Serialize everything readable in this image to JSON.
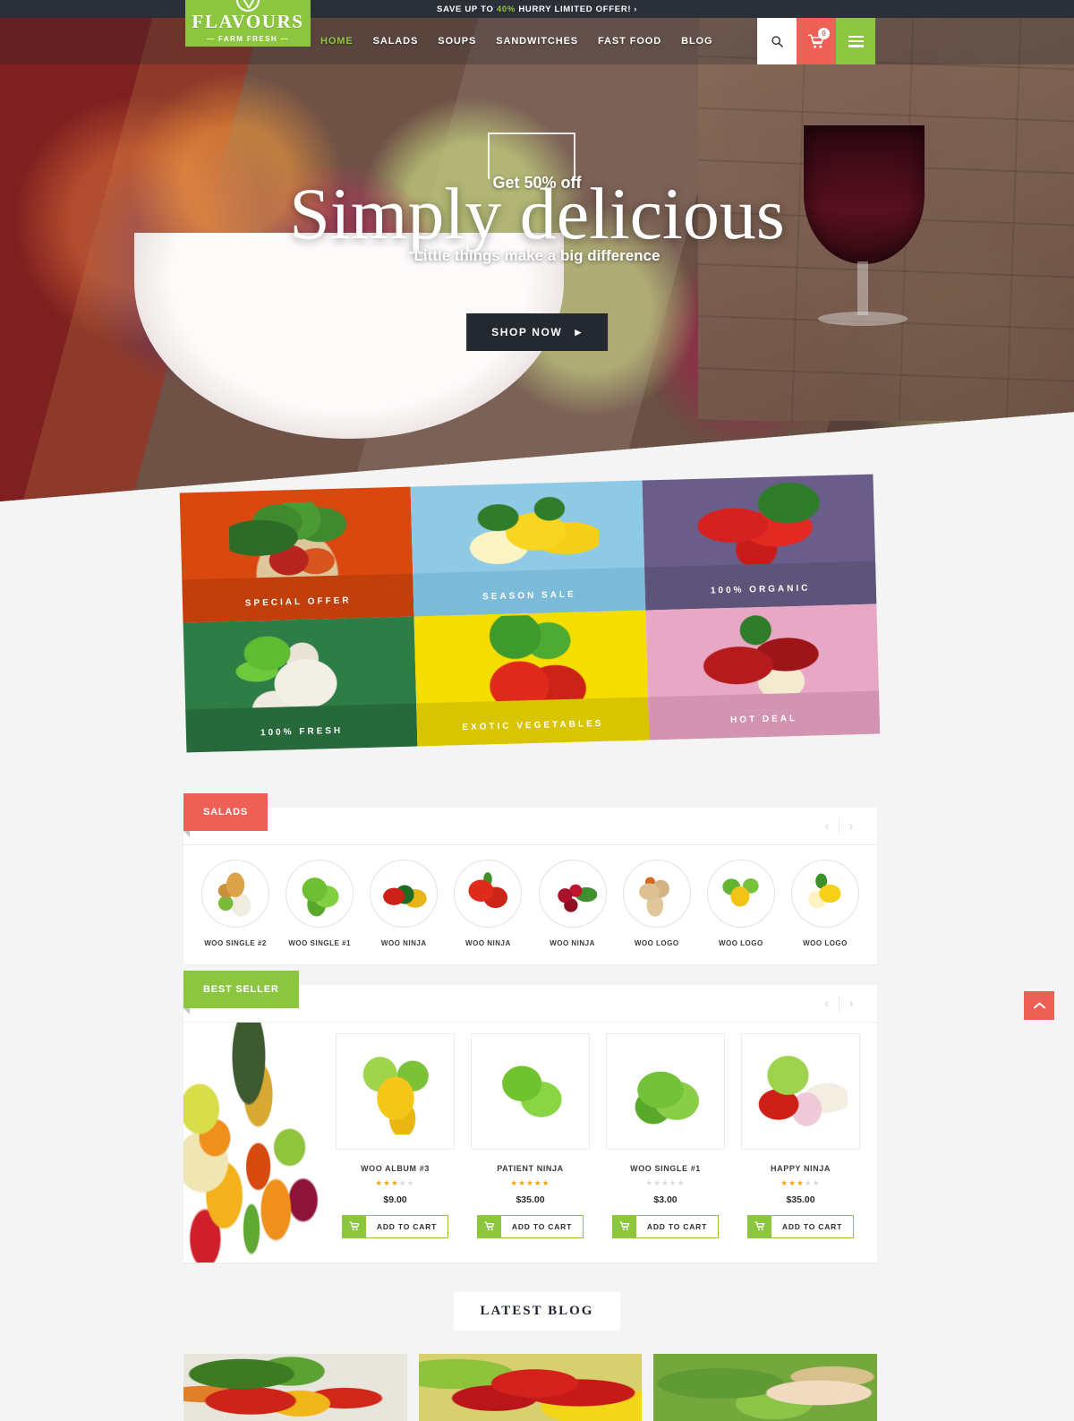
{
  "announcement": {
    "prefix": "SAVE UP TO ",
    "percent": "40%",
    "suffix": " HURRY LIMITED OFFER!",
    "arrow": "›"
  },
  "header": {
    "logo": {
      "name": "FLAVOURS",
      "tagline": "— FARM FRESH —",
      "icon": "lime-slice-icon"
    },
    "nav": [
      {
        "label": "HOME",
        "active": true
      },
      {
        "label": "SALADS",
        "active": false
      },
      {
        "label": "SOUPS",
        "active": false
      },
      {
        "label": "SANDWITCHES",
        "active": false
      },
      {
        "label": "FAST FOOD",
        "active": false
      },
      {
        "label": "BLOG",
        "active": false
      }
    ],
    "actions": {
      "search_icon": "search-icon",
      "cart_icon": "cart-icon",
      "cart_count": "0",
      "menu_icon": "hamburger-menu-icon"
    },
    "colors": {
      "green": "#8cc63e",
      "red": "#ee6055",
      "dark": "#2b2f38"
    }
  },
  "hero": {
    "kicker": "Get 50% off",
    "title": "Simply delicious",
    "subtitle": "Little things make a big difference",
    "cta": "SHOP NOW",
    "cta_caret": "▶"
  },
  "categories": [
    {
      "label": "SPECIAL OFFER",
      "bg": "#d9480f",
      "band": "#c23f0c",
      "art": "p-broccoli"
    },
    {
      "label": "SEASON SALE",
      "bg": "#8ecae6",
      "band": "#7cbada",
      "art": "p-lemon"
    },
    {
      "label": "100% ORGANIC",
      "bg": "#6a5d8a",
      "band": "#5e5379",
      "art": "p-straw"
    },
    {
      "label": "100% FRESH",
      "bg": "#2e7d46",
      "band": "#27693b",
      "art": "p-garlic"
    },
    {
      "label": "EXOTIC VEGETABLES",
      "bg": "#f5dd00",
      "band": "#d9c400",
      "art": "p-tomato"
    },
    {
      "label": "HOT DEAL",
      "bg": "#e8a7c4",
      "band": "#d294b0",
      "art": "p-apple"
    }
  ],
  "salads": {
    "tab_label": "SALADS",
    "prev": "‹",
    "next": "›",
    "items": [
      {
        "name": "WOO SINGLE #2",
        "art": "th-onion"
      },
      {
        "name": "WOO SINGLE #1",
        "art": "th-lettuce"
      },
      {
        "name": "WOO NINJA",
        "art": "th-pepper"
      },
      {
        "name": "WOO NINJA",
        "art": "th-tomato"
      },
      {
        "name": "WOO NINJA",
        "art": "th-cherry"
      },
      {
        "name": "WOO LOGO",
        "art": "th-wrap"
      },
      {
        "name": "WOO LOGO",
        "art": "th-corn"
      },
      {
        "name": "WOO LOGO",
        "art": "th-lemon2"
      }
    ]
  },
  "bestseller": {
    "tab_label": "BEST SELLER",
    "prev": "‹",
    "next": "›",
    "banner_alt": "mixed-fruit-banner",
    "add_to_cart": "ADD TO CART",
    "products": [
      {
        "name": "WOO ALBUM #3",
        "price": "$9.00",
        "rating": 3,
        "art": "bt-corn"
      },
      {
        "name": "PATIENT NINJA",
        "price": "$35.00",
        "rating": 5,
        "art": "bt-peas"
      },
      {
        "name": "WOO SINGLE #1",
        "price": "$3.00",
        "rating": 0,
        "art": "bt-lettuce"
      },
      {
        "name": "HAPPY NINJA",
        "price": "$35.00",
        "rating": 3,
        "art": "bt-mixveg"
      }
    ]
  },
  "blog": {
    "title": "LATEST BLOG",
    "cards": [
      {
        "alt": "vegetables-on-table",
        "art": "bc1"
      },
      {
        "alt": "strawberries-in-bowl",
        "art": "bc2"
      },
      {
        "alt": "woman-eating-apple",
        "art": "bc3"
      }
    ]
  },
  "scroll_top": {
    "icon": "chevron-up-icon"
  }
}
